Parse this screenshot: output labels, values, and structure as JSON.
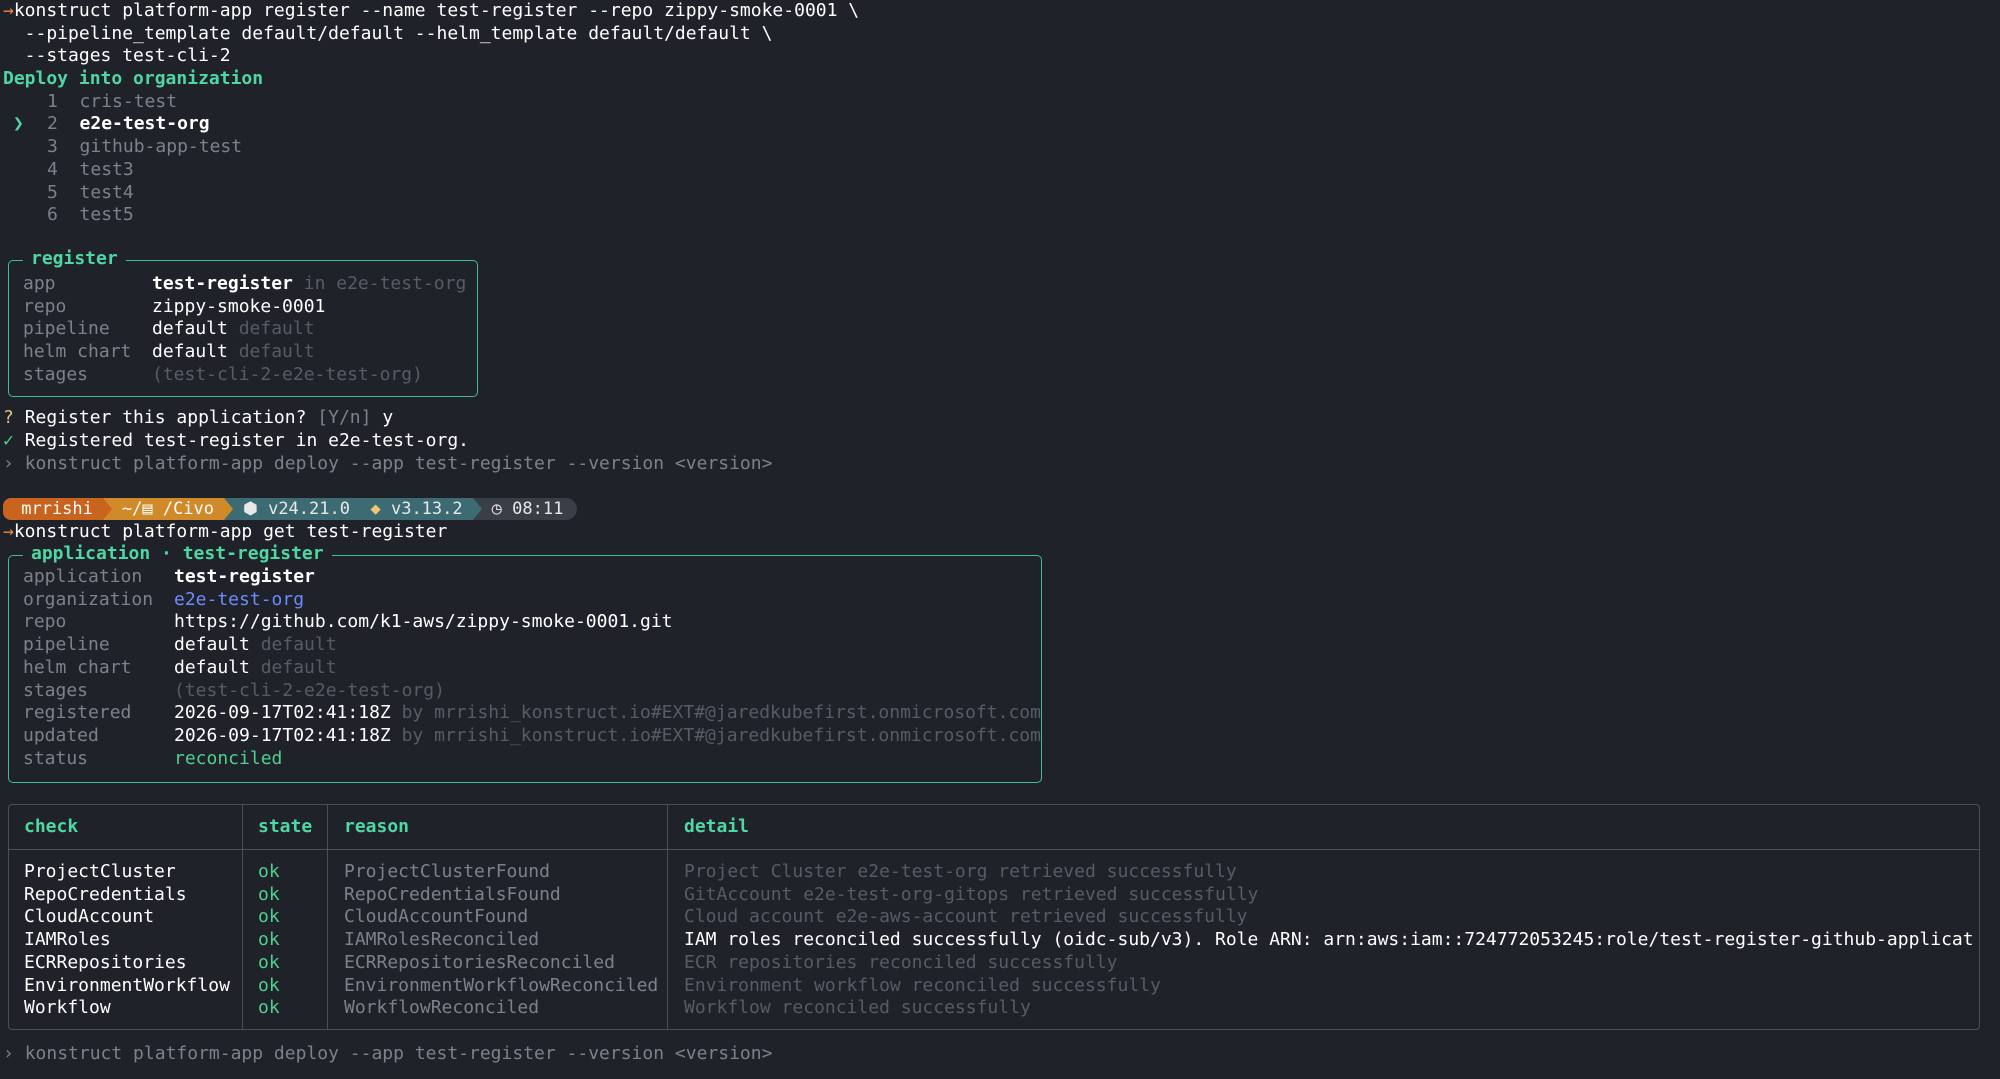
{
  "cmd1": {
    "line1": "konstruct platform-app register --name test-register --repo zippy-smoke-0001 \\",
    "line2": "  --pipeline_template default/default --helm_template default/default \\",
    "line3": "  --stages test-cli-2"
  },
  "org_select": {
    "prompt": "Deploy into organization",
    "cursor": "❯",
    "items": [
      {
        "num": "1",
        "name": "cris-test"
      },
      {
        "num": "2",
        "name": "e2e-test-org"
      },
      {
        "num": "3",
        "name": "github-app-test"
      },
      {
        "num": "4",
        "name": "test3"
      },
      {
        "num": "5",
        "name": "test4"
      },
      {
        "num": "6",
        "name": "test5"
      }
    ],
    "selected": 1
  },
  "register_box": {
    "title": "register",
    "rows": [
      {
        "key": "app",
        "value": "test-register",
        "extra": "in e2e-test-org"
      },
      {
        "key": "repo",
        "value": "zippy-smoke-0001",
        "extra": ""
      },
      {
        "key": "pipeline",
        "value": "default",
        "extra": "default"
      },
      {
        "key": "helm chart",
        "value": "default",
        "extra": "default"
      },
      {
        "key": "stages",
        "value": "",
        "extra": "(test-cli-2-e2e-test-org)"
      }
    ]
  },
  "confirm": {
    "mark": "?",
    "question": "Register this application?",
    "options": "[Y/n]",
    "answer": "y"
  },
  "success": {
    "mark": "✓",
    "text": "Registered test-register in e2e-test-org."
  },
  "hint1": {
    "mark": "›",
    "text": "konstruct platform-app deploy --app test-register --version <version>"
  },
  "prompt_bar": {
    "user": " mrrishi",
    "path": "~/▤ /Civo",
    "node": "⬢ v24.21.0",
    "python": "v3.13.2",
    "time": "08:11"
  },
  "cmd2": {
    "arrow": "→",
    "text": "konstruct platform-app get test-register"
  },
  "app_box": {
    "title": "application · test-register",
    "rows": [
      {
        "key": "application",
        "value": "test-register",
        "extra": "",
        "style": "bold"
      },
      {
        "key": "organization",
        "value": "e2e-test-org",
        "extra": "",
        "style": "blue"
      },
      {
        "key": "repo",
        "value": "https://github.com/k1-aws/zippy-smoke-0001.git",
        "extra": "",
        "style": "white"
      },
      {
        "key": "pipeline",
        "value": "default",
        "extra": "default",
        "style": "white"
      },
      {
        "key": "helm chart",
        "value": "default",
        "extra": "default",
        "style": "white"
      },
      {
        "key": "stages",
        "value": "",
        "extra": "(test-cli-2-e2e-test-org)",
        "style": "white"
      },
      {
        "key": "registered",
        "value": "2026-09-17T02:41:18Z",
        "extra": "by mrrishi_konstruct.io#EXT#@jaredkubefirst.onmicrosoft.com",
        "style": "white"
      },
      {
        "key": "updated",
        "value": "2026-09-17T02:41:18Z",
        "extra": "by mrrishi_konstruct.io#EXT#@jaredkubefirst.onmicrosoft.com",
        "style": "white"
      },
      {
        "key": "status",
        "value": "reconciled",
        "extra": "",
        "style": "green"
      }
    ]
  },
  "checks_table": {
    "headers": [
      "check",
      "state",
      "reason",
      "detail"
    ],
    "rows": [
      {
        "check": "ProjectCluster",
        "state": "ok",
        "reason": "ProjectClusterFound",
        "detail": "Project Cluster e2e-test-org retrieved successfully",
        "highlight": false
      },
      {
        "check": "RepoCredentials",
        "state": "ok",
        "reason": "RepoCredentialsFound",
        "detail": "GitAccount e2e-test-org-gitops retrieved successfully",
        "highlight": false
      },
      {
        "check": "CloudAccount",
        "state": "ok",
        "reason": "CloudAccountFound",
        "detail": "Cloud account e2e-aws-account retrieved successfully",
        "highlight": false
      },
      {
        "check": "IAMRoles",
        "state": "ok",
        "reason": "IAMRolesReconciled",
        "detail": "IAM roles reconciled successfully (oidc-sub/v3). Role ARN: arn:aws:iam::724772053245:role/test-register-github-applicat…",
        "highlight": true
      },
      {
        "check": "ECRRepositories",
        "state": "ok",
        "reason": "ECRRepositoriesReconciled",
        "detail": "ECR repositories reconciled successfully",
        "highlight": false
      },
      {
        "check": "EnvironmentWorkflow",
        "state": "ok",
        "reason": "EnvironmentWorkflowReconciled",
        "detail": "Environment workflow reconciled successfully",
        "highlight": false
      },
      {
        "check": "Workflow",
        "state": "ok",
        "reason": "WorkflowReconciled",
        "detail": "Workflow reconciled successfully",
        "highlight": false
      }
    ]
  },
  "hint2": {
    "mark": "›",
    "text": "konstruct platform-app deploy --app test-register --version <version>"
  }
}
